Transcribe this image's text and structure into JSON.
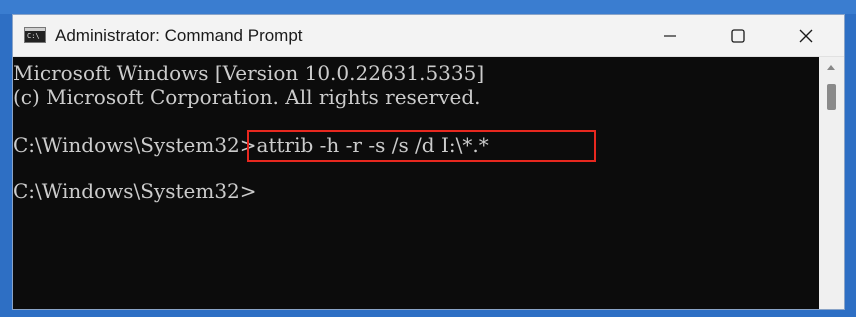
{
  "window": {
    "title": "Administrator: Command Prompt",
    "app_icon_text": "C:\\",
    "controls": {
      "minimize_icon": "minimize-icon",
      "maximize_icon": "maximize-icon",
      "close_icon": "close-icon"
    }
  },
  "console": {
    "lines": [
      "Microsoft Windows [Version 10.0.22631.5335]",
      "(c) Microsoft Corporation. All rights reserved.",
      "C:\\Windows\\System32>attrib -h -r -s /s /d I:\\*.*",
      "C:\\Windows\\System32>"
    ],
    "highlighted_command": "attrib -h -r -s /s /d I:\\*.*",
    "background": "#0c0c0c",
    "foreground": "#cccccc",
    "highlight_color": "#e8281f"
  }
}
